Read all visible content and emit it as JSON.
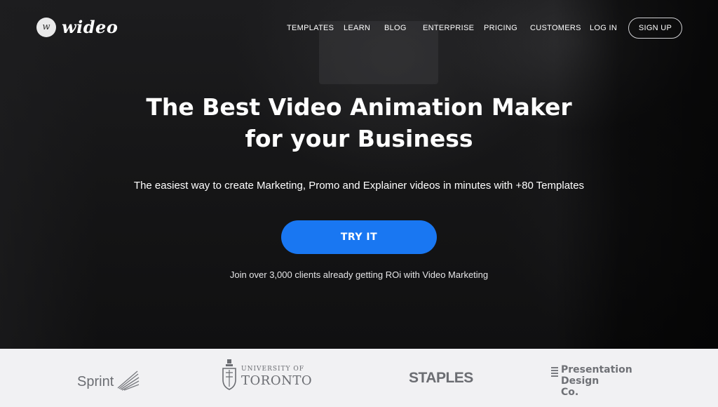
{
  "brand": {
    "logo_mark": "w",
    "name": "wideo"
  },
  "nav": {
    "items": [
      {
        "label": "TEMPLATES"
      },
      {
        "label": "LEARN"
      },
      {
        "label": "BLOG"
      },
      {
        "label": "ENTERPRISE"
      },
      {
        "label": "PRICING"
      },
      {
        "label": "CUSTOMERS"
      },
      {
        "label": "LOG IN"
      }
    ],
    "signup_label": "SIGN UP"
  },
  "hero": {
    "headline_line1": "The Best Video Animation Maker",
    "headline_line2": "for your Business",
    "subhead": "The easiest way to create Marketing, Promo and Explainer videos in minutes with +80 Templates",
    "cta_label": "TRY IT",
    "social_proof": "Join over 3,000 clients already getting ROi with Video Marketing"
  },
  "clients": {
    "sprint": "Sprint",
    "toronto_small": "UNIVERSITY OF",
    "toronto_big": "TORONTO",
    "staples": "STAPLES",
    "pdc_line1": "Presentation",
    "pdc_line2": "Design",
    "pdc_line3": "Co."
  },
  "colors": {
    "accent": "#1977f2",
    "strip_background": "#f1f1f3",
    "logo_gray": "#6b6d72"
  },
  "icons": [
    "wideo-logo-icon",
    "sprint-wing-icon",
    "university-crest-icon",
    "presentation-lines-icon"
  ]
}
